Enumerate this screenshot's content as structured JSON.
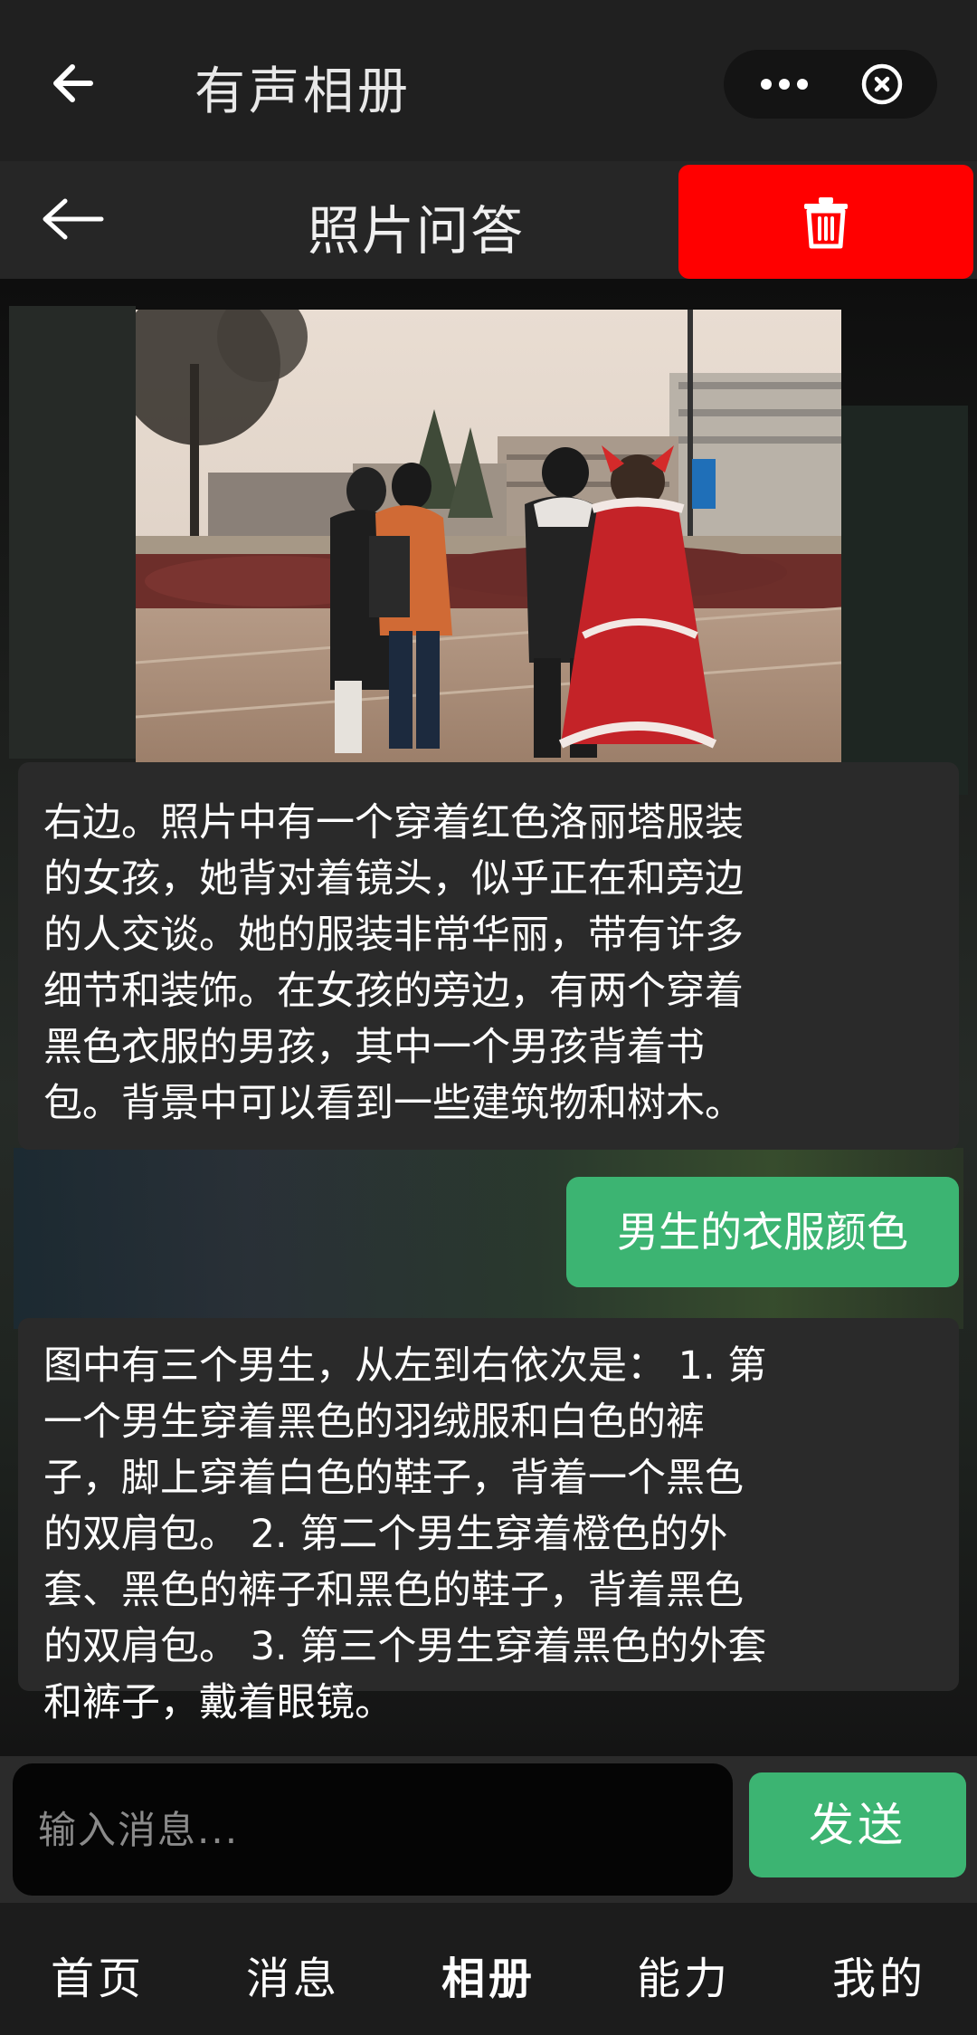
{
  "header": {
    "title": "有声相册"
  },
  "subheader": {
    "title": "照片问答"
  },
  "colors": {
    "accent_green": "#3cb472",
    "delete_red": "#ff0000",
    "background": "#111111"
  },
  "icons": {
    "back": "arrow-left-icon",
    "more": "more-dots-icon",
    "close": "close-circle-icon",
    "delete": "trash-icon"
  },
  "chat": {
    "ai_message_1_lines": [
      "右边。照片中有一个穿着红色洛丽塔服装",
      "的女孩，她背对着镜头，似乎正在和旁边",
      "的人交谈。她的服装非常华丽，带有许多",
      "细节和装饰。在女孩的旁边，有两个穿着",
      "黑色衣服的男孩，其中一个男孩背着书",
      "包。背景中可以看到一些建筑物和树木。"
    ],
    "user_message": "男生的衣服颜色",
    "ai_message_2_lines": [
      "图中有三个男生，从左到右依次是： 1. 第",
      "一个男生穿着黑色的羽绒服和白色的裤",
      "子，脚上穿着白色的鞋子，背着一个黑色",
      "的双肩包。 2. 第二个男生穿着橙色的外",
      "套、黑色的裤子和黑色的鞋子，背着黑色",
      "的双肩包。 3. 第三个男生穿着黑色的外套",
      "和裤子，戴着眼镜。"
    ]
  },
  "input": {
    "placeholder": "输入消息...",
    "value": "",
    "send_label": "发送"
  },
  "tabs": [
    {
      "label": "首页",
      "active": false
    },
    {
      "label": "消息",
      "active": false
    },
    {
      "label": "相册",
      "active": true
    },
    {
      "label": "能力",
      "active": false
    },
    {
      "label": "我的",
      "active": false
    }
  ]
}
